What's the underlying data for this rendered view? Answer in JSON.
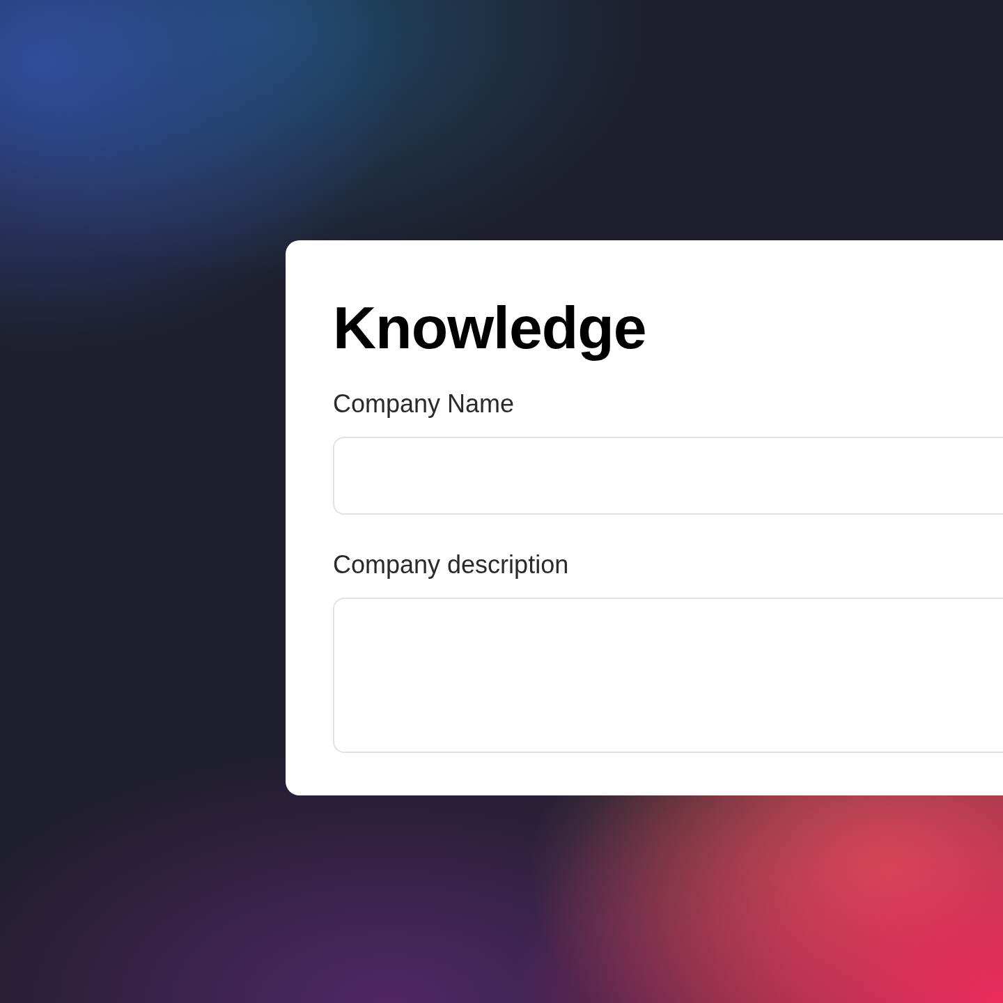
{
  "card": {
    "title": "Knowledge",
    "fields": [
      {
        "kind": "input",
        "label": "Company Name"
      },
      {
        "kind": "textarea",
        "label": "Company description"
      }
    ]
  }
}
